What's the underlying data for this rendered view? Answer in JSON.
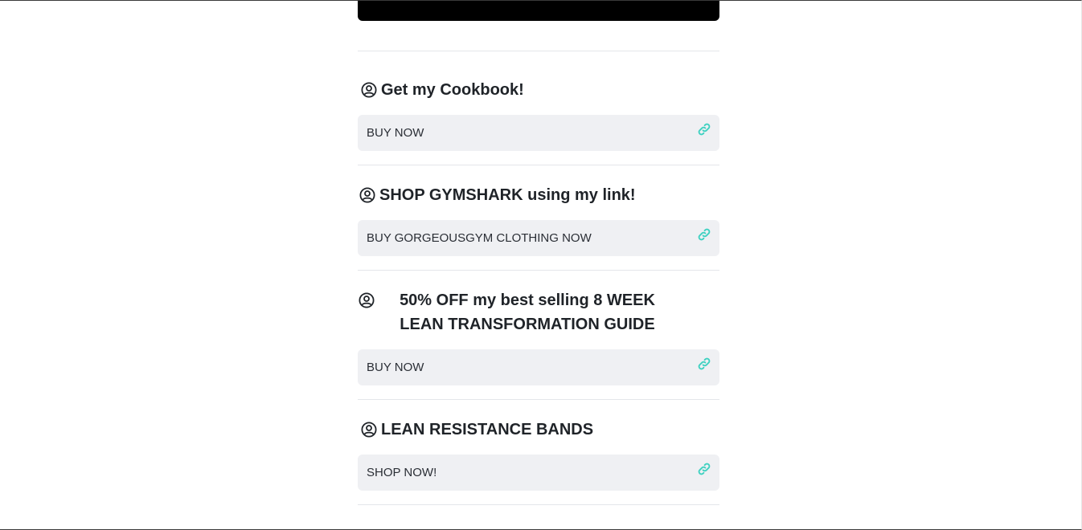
{
  "groups": [
    {
      "title": "Get my Cookbook!",
      "title_icon": "user-circle-icon",
      "button_label": "BUY NOW",
      "link_icon": "link-icon"
    },
    {
      "title": "SHOP GYMSHARK using my link!",
      "title_icon": "user-circle-icon",
      "button_label": "BUY GORGEOUSGYM CLOTHING NOW",
      "link_icon": "link-icon"
    },
    {
      "title": "50% OFF my best selling 8 WEEK LEAN TRANSFORMATION GUIDE",
      "title_icon": "user-circle-icon",
      "button_label": "BUY NOW",
      "link_icon": "link-icon"
    },
    {
      "title": "LEAN RESISTANCE BANDS",
      "title_icon": "user-circle-icon",
      "button_label": "SHOP NOW!",
      "link_icon": "link-icon"
    }
  ],
  "colors": {
    "link_icon": "#3fd1c1",
    "card_background": "#eff0f3",
    "text": "#1f2328"
  }
}
